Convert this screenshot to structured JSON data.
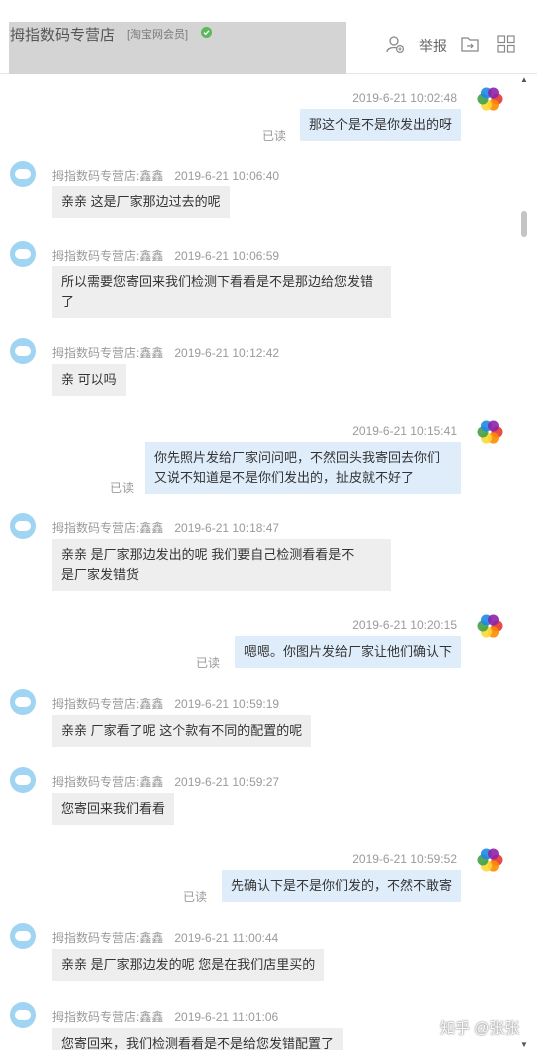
{
  "header": {
    "shop_title": "拇指数码专营店",
    "shop_badge": "[淘宝网会员]",
    "report_label": "举报",
    "icons": [
      "verified-check-icon",
      "add-contact-icon",
      "folder-share-icon",
      "grid-apps-icon"
    ]
  },
  "colors": {
    "bubble_incoming": "#eeeeee",
    "bubble_outgoing": "#dfedfb",
    "shop_avatar": "#9fd4f2",
    "meta_text": "#9a9a9a"
  },
  "messages": [
    {
      "dir": "out",
      "time": "2019-6-21 10:02:48",
      "read": "已读",
      "text": [
        "那这个是不是你发出的呀"
      ]
    },
    {
      "dir": "in",
      "sender": "拇指数码专营店:鑫鑫",
      "time": "2019-6-21 10:06:40",
      "text": [
        "亲亲  这是厂家那边过去的呢"
      ]
    },
    {
      "dir": "in",
      "sender": "拇指数码专营店:鑫鑫",
      "time": "2019-6-21 10:06:59",
      "text": [
        "所以需要您寄回来我们检测下看看是不是那边给您发错",
        "了"
      ]
    },
    {
      "dir": "in",
      "sender": "拇指数码专营店:鑫鑫",
      "time": "2019-6-21 10:12:42",
      "text": [
        "亲 可以吗"
      ]
    },
    {
      "dir": "out",
      "time": "2019-6-21 10:15:41",
      "read": "已读",
      "text": [
        "你先照片发给厂家问问吧，不然回头我寄回去你们",
        "又说不知道是不是你们发出的，扯皮就不好了"
      ]
    },
    {
      "dir": "in",
      "sender": "拇指数码专营店:鑫鑫",
      "time": "2019-6-21 10:18:47",
      "text": [
        "亲亲  是厂家那边发出的呢  我们要自己检测看看是不",
        "是厂家发错货"
      ]
    },
    {
      "dir": "out",
      "time": "2019-6-21 10:20:15",
      "read": "已读",
      "text": [
        "嗯嗯。你图片发给厂家让他们确认下"
      ]
    },
    {
      "dir": "in",
      "sender": "拇指数码专营店:鑫鑫",
      "time": "2019-6-21 10:59:19",
      "text": [
        "亲亲  厂家看了呢  这个款有不同的配置的呢"
      ]
    },
    {
      "dir": "in",
      "sender": "拇指数码专营店:鑫鑫",
      "time": "2019-6-21 10:59:27",
      "text": [
        "您寄回来我们看看"
      ]
    },
    {
      "dir": "out",
      "time": "2019-6-21 10:59:52",
      "read": "已读",
      "text": [
        "先确认下是不是你们发的，不然不敢寄"
      ]
    },
    {
      "dir": "in",
      "sender": "拇指数码专营店:鑫鑫",
      "time": "2019-6-21 11:00:44",
      "text": [
        "亲亲 是厂家那边发的呢  您是在我们店里买的"
      ]
    },
    {
      "dir": "in",
      "sender": "拇指数码专营店:鑫鑫",
      "time": "2019-6-21 11:01:06",
      "text": [
        "您寄回来，我们检测看看是不是给您发错配置了"
      ]
    }
  ],
  "watermark": "知乎 @张张"
}
